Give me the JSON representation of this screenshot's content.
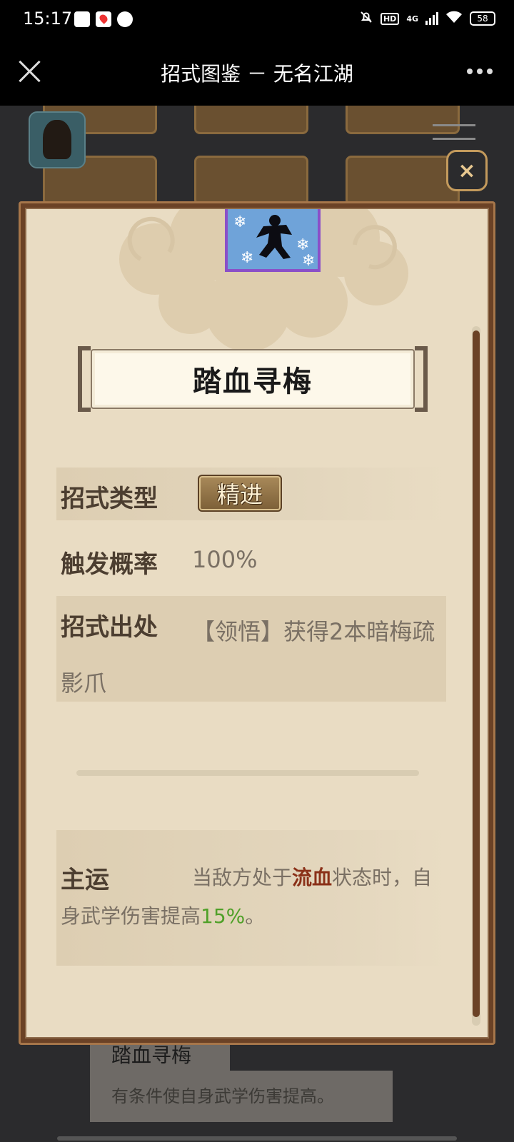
{
  "status_bar": {
    "time": "15:17",
    "network": "4G",
    "hd": "HD",
    "battery": "58"
  },
  "title_bar": {
    "title": "招式图鉴 － 无名江湖"
  },
  "background": {
    "tooltip_title": "踏血寻梅",
    "tooltip_desc": "有条件使自身武学伤害提高。"
  },
  "modal": {
    "close_label": "×",
    "skill_name": "踏血寻梅",
    "type_label": "招式类型",
    "type_value": "精进",
    "rate_label": "触发概率",
    "rate_value": "100%",
    "source_label": "招式出处",
    "source_value": "【领悟】获得2本暗梅疏影爪",
    "main_label": "主运",
    "main_text_1": "当敌方处于",
    "main_highlight": "流血",
    "main_text_2": "状态时，自身武学伤害提高",
    "main_percent": "15%",
    "main_text_3": "。"
  },
  "colors": {
    "panel_bg": "#e9dcc3",
    "frame": "#6b4226",
    "highlight_red": "#8a3018",
    "highlight_green": "#4fa028"
  }
}
